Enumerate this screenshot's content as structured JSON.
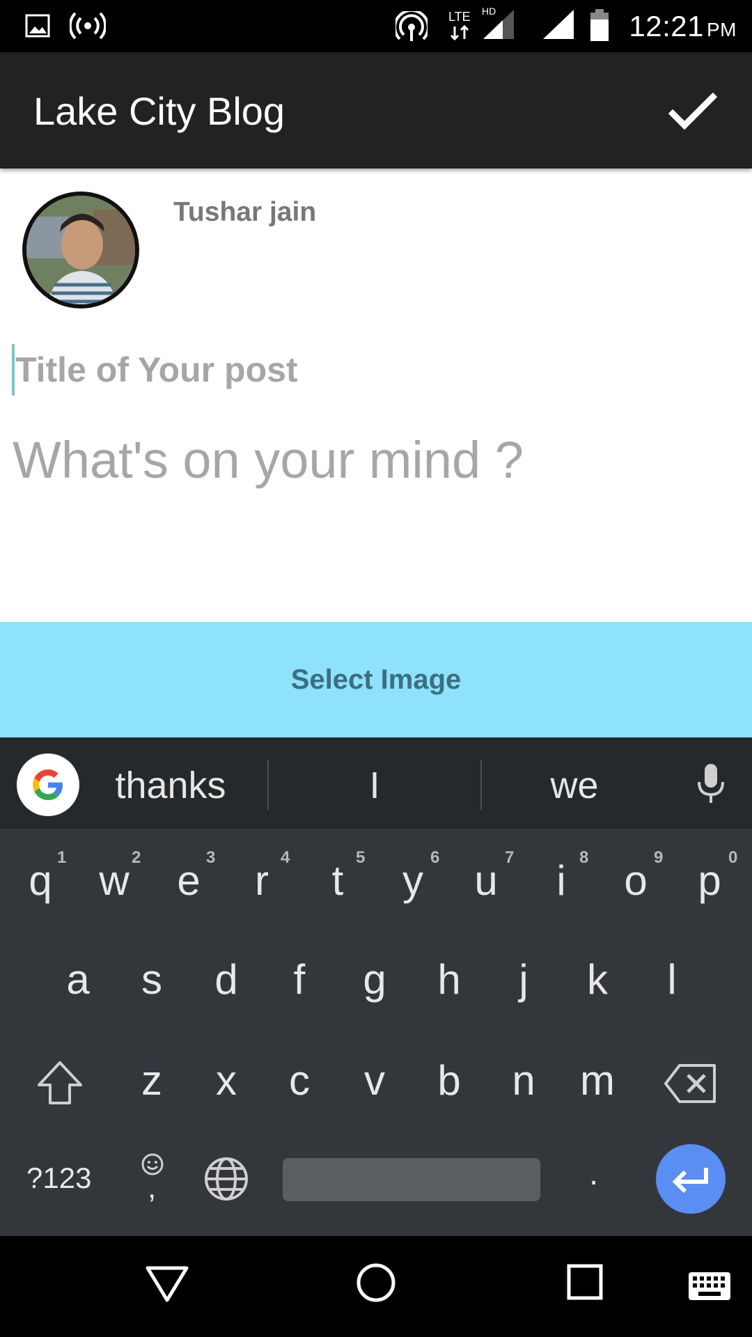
{
  "status_bar": {
    "time": "12:21",
    "ampm": "PM",
    "network_label": "LTE",
    "hd_label": "HD",
    "icons": [
      "image-icon",
      "hotspot-broadcast-icon",
      "wifi-calling-icon",
      "lte-data-icon",
      "signal-hd-icon",
      "signal-icon",
      "battery-icon"
    ]
  },
  "app_bar": {
    "title": "Lake City Blog",
    "confirm_icon": "check-icon"
  },
  "post": {
    "user_name": "Tushar jain",
    "title_placeholder": "Title of Your post",
    "body_placeholder": "What's on your mind ?",
    "select_image_label": "Select Image"
  },
  "keyboard": {
    "suggestions": [
      "thanks",
      "I",
      "we"
    ],
    "row1": [
      "q",
      "w",
      "e",
      "r",
      "t",
      "y",
      "u",
      "i",
      "o",
      "p"
    ],
    "row1_hints": [
      "1",
      "2",
      "3",
      "4",
      "5",
      "6",
      "7",
      "8",
      "9",
      "0"
    ],
    "row2": [
      "a",
      "s",
      "d",
      "f",
      "g",
      "h",
      "j",
      "k",
      "l"
    ],
    "row3": [
      "z",
      "x",
      "c",
      "v",
      "b",
      "n",
      "m"
    ],
    "symbols_label": "?123",
    "period_label": ".",
    "comma_label": ",",
    "accent_color": "#5a8ef2"
  },
  "nav_bar": {
    "icons": [
      "back-icon",
      "home-icon",
      "recents-icon",
      "keyboard-icon"
    ]
  },
  "colors": {
    "app_bar": "#222222",
    "select_image_bg": "#8ee2fb",
    "keyboard_bg": "#33373c"
  }
}
